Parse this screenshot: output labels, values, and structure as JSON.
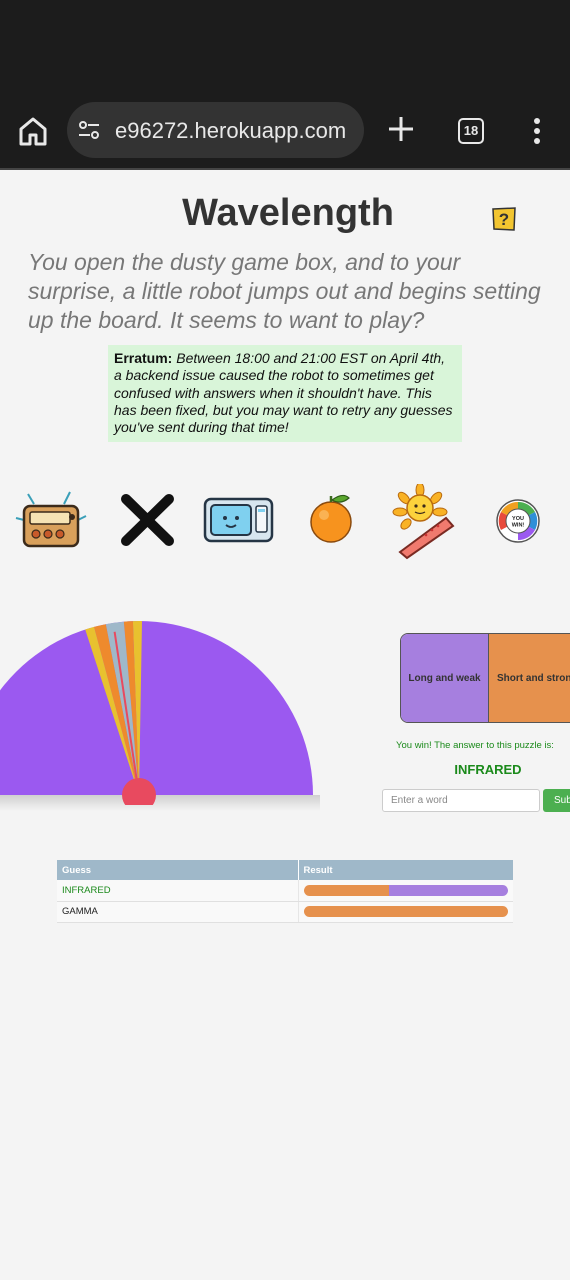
{
  "browser": {
    "url": "e96272.herokuapp.com",
    "tab_count": "18"
  },
  "page": {
    "title": "Wavelength",
    "intro": "You open the dusty game box, and to your surprise, a little robot jumps out and begins setting up the board. It seems to want to play?",
    "erratum_label": "Erratum:",
    "erratum_text": " Between 18:00 and 21:00 EST on April 4th, a backend issue caused the robot to sometimes get confused with answers when it shouldn't have. This has been fixed, but you may want to retry any guesses you've sent during that time!"
  },
  "clue_icons": [
    "radio-icon",
    "x-icon",
    "microwave-icon",
    "orange-icon",
    "sunburn-icon",
    "you-win-wheel-icon"
  ],
  "clue_icon_text": {
    "you_win": "YOU WIN!"
  },
  "gauge": {
    "base_color": "#9b59f0",
    "bands": [
      "#e8c12f",
      "#ee8a2d",
      "#9fb8c9"
    ],
    "pointer_color": "#e84a5f"
  },
  "spectrum": {
    "left_label": "Long and weak",
    "right_label": "Short and strong",
    "left_color": "#a67fdf",
    "right_color": "#e6914d"
  },
  "result": {
    "win_message": "You win! The answer to this puzzle is:",
    "answer": "INFRARED",
    "input_placeholder": "Enter a word",
    "submit_label": "Submit"
  },
  "guesses": {
    "headers": [
      "Guess",
      "Result"
    ],
    "rows": [
      {
        "word": "INFRARED",
        "orange_fraction": 0.42,
        "purple_fraction": 0.58,
        "status_color": "#1b8a1b"
      },
      {
        "word": "GAMMA",
        "orange_fraction": 1.0,
        "purple_fraction": 0.0,
        "status_color": "#222222"
      }
    ]
  }
}
